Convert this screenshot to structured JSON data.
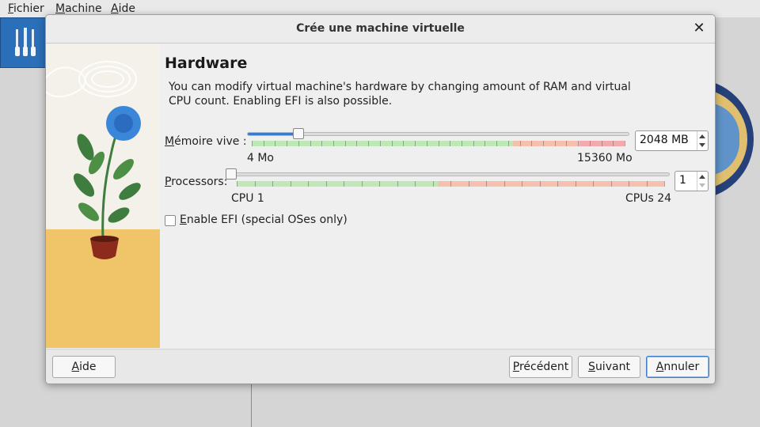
{
  "app": {
    "menu": [
      "Fichier",
      "Machine",
      "Aide"
    ]
  },
  "dialog": {
    "title": "Crée une machine virtuelle",
    "close_symbol": "✕",
    "page_title": "Hardware",
    "description": "You can modify virtual machine's hardware by changing amount of RAM and virtual CPU count. Enabling EFI is also possible."
  },
  "memory": {
    "label_first": "M",
    "label_rest": "émoire vive :",
    "value": "2048 MB",
    "min_label": "4 Mo",
    "max_label": "15360 Mo",
    "min": 4,
    "max": 15360,
    "current": 2048,
    "zones": {
      "green_until": 0.7,
      "orange_until": 0.88
    }
  },
  "processors": {
    "label_first": "P",
    "label_rest": "rocessors:",
    "value": "1",
    "min_label": "CPU 1",
    "max_label": "CPUs 24",
    "min": 1,
    "max": 24,
    "current": 1,
    "zones": {
      "green_until": 0.47,
      "orange_until": 1.0
    }
  },
  "efi": {
    "label_first": "E",
    "label_rest": "nable EFI (special OSes only)",
    "checked": false
  },
  "buttons": {
    "help": "Aide",
    "previous": "Précédent",
    "next": "Suivant",
    "cancel": "Annuler"
  },
  "colors": {
    "accent": "#3a7ac7",
    "zone_green": "#bfe8b7",
    "zone_orange": "#f5c0ad",
    "zone_red": "#f3aaae"
  },
  "icons": {
    "app_tool": "tools-icon",
    "close": "close-icon",
    "spin_up": "chevron-up-icon",
    "spin_down": "chevron-down-icon",
    "illustration": "plant-illustration"
  }
}
